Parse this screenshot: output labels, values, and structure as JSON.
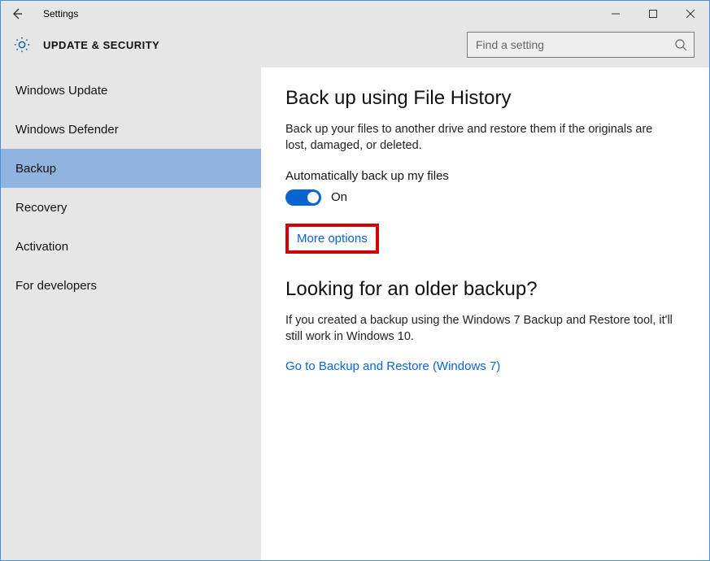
{
  "window": {
    "title": "Settings"
  },
  "header": {
    "category": "UPDATE & SECURITY",
    "search_placeholder": "Find a setting"
  },
  "sidebar": {
    "items": [
      {
        "label": "Windows Update",
        "selected": false
      },
      {
        "label": "Windows Defender",
        "selected": false
      },
      {
        "label": "Backup",
        "selected": true
      },
      {
        "label": "Recovery",
        "selected": false
      },
      {
        "label": "Activation",
        "selected": false
      },
      {
        "label": "For developers",
        "selected": false
      }
    ]
  },
  "main": {
    "section1": {
      "heading": "Back up using File History",
      "description": "Back up your files to another drive and restore them if the originals are lost, damaged, or deleted.",
      "toggle_label": "Automatically back up my files",
      "toggle_state": "On",
      "more_options": "More options"
    },
    "section2": {
      "heading": "Looking for an older backup?",
      "description": "If you created a backup using the Windows 7 Backup and Restore tool, it'll still work in Windows 10.",
      "link": "Go to Backup and Restore (Windows 7)"
    }
  },
  "highlight": {
    "target": "more-options-link"
  }
}
